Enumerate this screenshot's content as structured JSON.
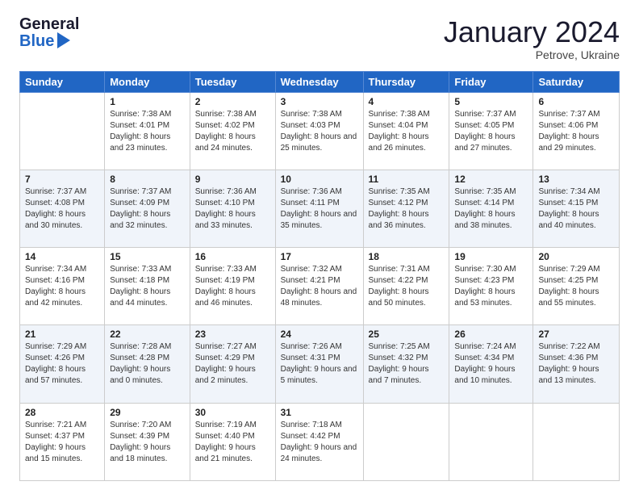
{
  "logo": {
    "line1": "General",
    "line2": "Blue"
  },
  "header": {
    "month": "January 2024",
    "location": "Petrove, Ukraine"
  },
  "weekdays": [
    "Sunday",
    "Monday",
    "Tuesday",
    "Wednesday",
    "Thursday",
    "Friday",
    "Saturday"
  ],
  "weeks": [
    [
      {
        "day": "",
        "sunrise": "",
        "sunset": "",
        "daylight": ""
      },
      {
        "day": "1",
        "sunrise": "Sunrise: 7:38 AM",
        "sunset": "Sunset: 4:01 PM",
        "daylight": "Daylight: 8 hours and 23 minutes."
      },
      {
        "day": "2",
        "sunrise": "Sunrise: 7:38 AM",
        "sunset": "Sunset: 4:02 PM",
        "daylight": "Daylight: 8 hours and 24 minutes."
      },
      {
        "day": "3",
        "sunrise": "Sunrise: 7:38 AM",
        "sunset": "Sunset: 4:03 PM",
        "daylight": "Daylight: 8 hours and 25 minutes."
      },
      {
        "day": "4",
        "sunrise": "Sunrise: 7:38 AM",
        "sunset": "Sunset: 4:04 PM",
        "daylight": "Daylight: 8 hours and 26 minutes."
      },
      {
        "day": "5",
        "sunrise": "Sunrise: 7:37 AM",
        "sunset": "Sunset: 4:05 PM",
        "daylight": "Daylight: 8 hours and 27 minutes."
      },
      {
        "day": "6",
        "sunrise": "Sunrise: 7:37 AM",
        "sunset": "Sunset: 4:06 PM",
        "daylight": "Daylight: 8 hours and 29 minutes."
      }
    ],
    [
      {
        "day": "7",
        "sunrise": "Sunrise: 7:37 AM",
        "sunset": "Sunset: 4:08 PM",
        "daylight": "Daylight: 8 hours and 30 minutes."
      },
      {
        "day": "8",
        "sunrise": "Sunrise: 7:37 AM",
        "sunset": "Sunset: 4:09 PM",
        "daylight": "Daylight: 8 hours and 32 minutes."
      },
      {
        "day": "9",
        "sunrise": "Sunrise: 7:36 AM",
        "sunset": "Sunset: 4:10 PM",
        "daylight": "Daylight: 8 hours and 33 minutes."
      },
      {
        "day": "10",
        "sunrise": "Sunrise: 7:36 AM",
        "sunset": "Sunset: 4:11 PM",
        "daylight": "Daylight: 8 hours and 35 minutes."
      },
      {
        "day": "11",
        "sunrise": "Sunrise: 7:35 AM",
        "sunset": "Sunset: 4:12 PM",
        "daylight": "Daylight: 8 hours and 36 minutes."
      },
      {
        "day": "12",
        "sunrise": "Sunrise: 7:35 AM",
        "sunset": "Sunset: 4:14 PM",
        "daylight": "Daylight: 8 hours and 38 minutes."
      },
      {
        "day": "13",
        "sunrise": "Sunrise: 7:34 AM",
        "sunset": "Sunset: 4:15 PM",
        "daylight": "Daylight: 8 hours and 40 minutes."
      }
    ],
    [
      {
        "day": "14",
        "sunrise": "Sunrise: 7:34 AM",
        "sunset": "Sunset: 4:16 PM",
        "daylight": "Daylight: 8 hours and 42 minutes."
      },
      {
        "day": "15",
        "sunrise": "Sunrise: 7:33 AM",
        "sunset": "Sunset: 4:18 PM",
        "daylight": "Daylight: 8 hours and 44 minutes."
      },
      {
        "day": "16",
        "sunrise": "Sunrise: 7:33 AM",
        "sunset": "Sunset: 4:19 PM",
        "daylight": "Daylight: 8 hours and 46 minutes."
      },
      {
        "day": "17",
        "sunrise": "Sunrise: 7:32 AM",
        "sunset": "Sunset: 4:21 PM",
        "daylight": "Daylight: 8 hours and 48 minutes."
      },
      {
        "day": "18",
        "sunrise": "Sunrise: 7:31 AM",
        "sunset": "Sunset: 4:22 PM",
        "daylight": "Daylight: 8 hours and 50 minutes."
      },
      {
        "day": "19",
        "sunrise": "Sunrise: 7:30 AM",
        "sunset": "Sunset: 4:23 PM",
        "daylight": "Daylight: 8 hours and 53 minutes."
      },
      {
        "day": "20",
        "sunrise": "Sunrise: 7:29 AM",
        "sunset": "Sunset: 4:25 PM",
        "daylight": "Daylight: 8 hours and 55 minutes."
      }
    ],
    [
      {
        "day": "21",
        "sunrise": "Sunrise: 7:29 AM",
        "sunset": "Sunset: 4:26 PM",
        "daylight": "Daylight: 8 hours and 57 minutes."
      },
      {
        "day": "22",
        "sunrise": "Sunrise: 7:28 AM",
        "sunset": "Sunset: 4:28 PM",
        "daylight": "Daylight: 9 hours and 0 minutes."
      },
      {
        "day": "23",
        "sunrise": "Sunrise: 7:27 AM",
        "sunset": "Sunset: 4:29 PM",
        "daylight": "Daylight: 9 hours and 2 minutes."
      },
      {
        "day": "24",
        "sunrise": "Sunrise: 7:26 AM",
        "sunset": "Sunset: 4:31 PM",
        "daylight": "Daylight: 9 hours and 5 minutes."
      },
      {
        "day": "25",
        "sunrise": "Sunrise: 7:25 AM",
        "sunset": "Sunset: 4:32 PM",
        "daylight": "Daylight: 9 hours and 7 minutes."
      },
      {
        "day": "26",
        "sunrise": "Sunrise: 7:24 AM",
        "sunset": "Sunset: 4:34 PM",
        "daylight": "Daylight: 9 hours and 10 minutes."
      },
      {
        "day": "27",
        "sunrise": "Sunrise: 7:22 AM",
        "sunset": "Sunset: 4:36 PM",
        "daylight": "Daylight: 9 hours and 13 minutes."
      }
    ],
    [
      {
        "day": "28",
        "sunrise": "Sunrise: 7:21 AM",
        "sunset": "Sunset: 4:37 PM",
        "daylight": "Daylight: 9 hours and 15 minutes."
      },
      {
        "day": "29",
        "sunrise": "Sunrise: 7:20 AM",
        "sunset": "Sunset: 4:39 PM",
        "daylight": "Daylight: 9 hours and 18 minutes."
      },
      {
        "day": "30",
        "sunrise": "Sunrise: 7:19 AM",
        "sunset": "Sunset: 4:40 PM",
        "daylight": "Daylight: 9 hours and 21 minutes."
      },
      {
        "day": "31",
        "sunrise": "Sunrise: 7:18 AM",
        "sunset": "Sunset: 4:42 PM",
        "daylight": "Daylight: 9 hours and 24 minutes."
      },
      {
        "day": "",
        "sunrise": "",
        "sunset": "",
        "daylight": ""
      },
      {
        "day": "",
        "sunrise": "",
        "sunset": "",
        "daylight": ""
      },
      {
        "day": "",
        "sunrise": "",
        "sunset": "",
        "daylight": ""
      }
    ]
  ]
}
